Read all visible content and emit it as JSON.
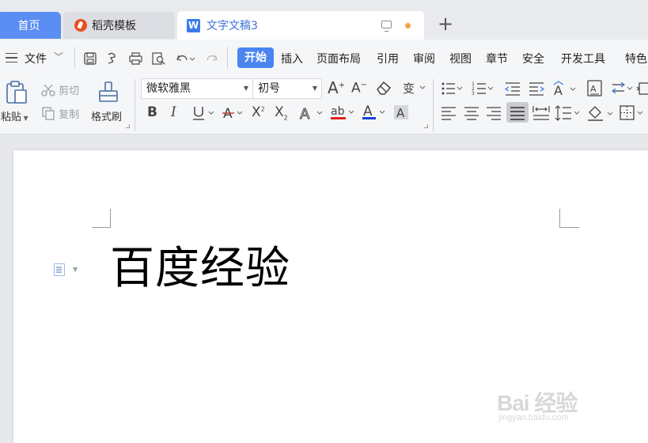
{
  "tabs": {
    "home": "首页",
    "template": "稻壳模板",
    "document": "文字文稿3",
    "doc_logo": "W"
  },
  "menu": {
    "file": "文件",
    "items": [
      "开始",
      "插入",
      "页面布局",
      "引用",
      "审阅",
      "视图",
      "章节",
      "安全",
      "开发工具",
      "特色"
    ]
  },
  "ribbon": {
    "paste": "粘贴",
    "cut": "剪切",
    "copy": "复制",
    "format_painter": "格式刷",
    "font_name": "微软雅黑",
    "font_size": "初号"
  },
  "document": {
    "body_text": "百度经验"
  },
  "watermark": {
    "brand": "Bai  经验",
    "url": "jingyan.baidu.com"
  },
  "colors": {
    "accent": "#4a85f0",
    "home_tab": "#5b8ef2",
    "font_color_underline": "#1a3fd6",
    "highlight_underline": "#e02020"
  }
}
